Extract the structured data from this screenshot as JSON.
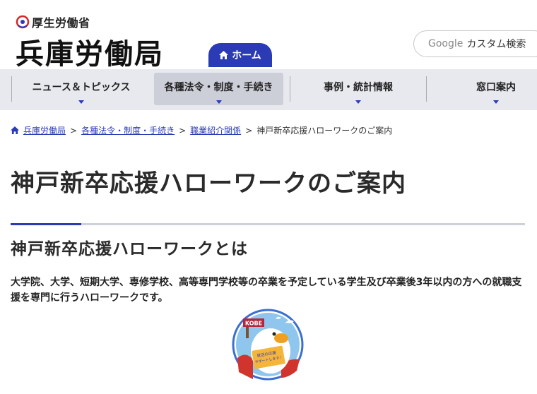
{
  "header": {
    "ministry_name": "厚生労働省",
    "bureau_title": "兵庫労働局",
    "home_label": "ホーム",
    "search": {
      "brand": "Google",
      "label": "カスタム検索"
    }
  },
  "nav": {
    "items": [
      {
        "label": "ニュース＆トピックス"
      },
      {
        "label": "各種法令・制度・手続き"
      },
      {
        "label": "事例・統計情報"
      },
      {
        "label": "窓口案内"
      }
    ]
  },
  "breadcrumb": {
    "items": [
      {
        "label": "兵庫労働局"
      },
      {
        "label": "各種法令・制度・手続き"
      },
      {
        "label": "職業紹介関係"
      },
      {
        "label": "神戸新卒応援ハローワークのご案内"
      }
    ],
    "separator": ">"
  },
  "main": {
    "page_title": "神戸新卒応援ハローワークのご案内",
    "section_heading": "神戸新卒応援ハローワークとは",
    "intro": "大学院、大学、短期大学、専修学校、高等専門学校等の卒業を予定している学生及び卒業後3年以内の方への就職支援を専門に行うハローワークです。"
  },
  "mascot": {
    "sign_text": "KOBE",
    "card_text_1": "就活の応援",
    "card_text_2": "サポートします！"
  },
  "colors": {
    "accent": "#2b3bb5",
    "nav_bg": "#e8e9ef",
    "nav_active": "#ccced8",
    "rule_gray": "#cfd0da"
  }
}
